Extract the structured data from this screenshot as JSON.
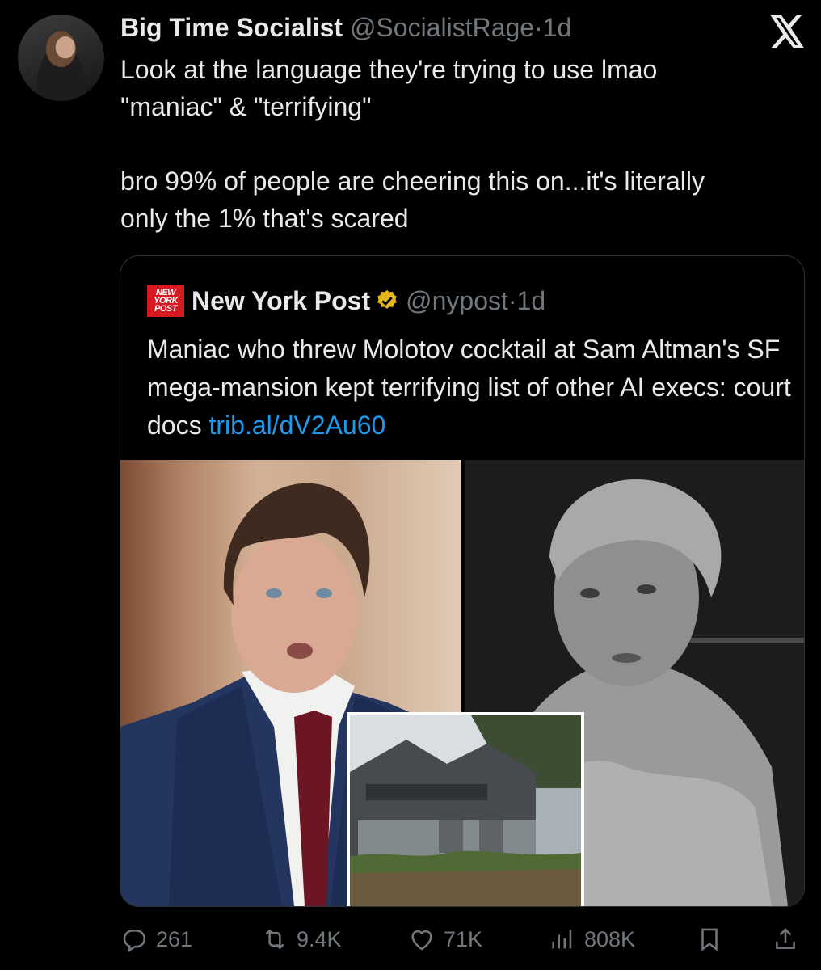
{
  "tweet": {
    "author_name": "Big Time Socialist",
    "handle": "@SocialistRage",
    "separator": "·",
    "time": "1d",
    "text_lines": [
      "Look at the language they're trying to use lmao",
      "\"maniac\" & \"terrifying\"",
      "",
      "bro 99% of people are cheering this on...it's literally",
      "only the 1% that's scared"
    ]
  },
  "quote": {
    "logo_lines": [
      "NEW",
      "YORK",
      "POST"
    ],
    "author_name": "New York Post",
    "handle": "@nypost",
    "separator": "·",
    "time": "1d",
    "text": "Maniac who threw Molotov cocktail at Sam Altman's SF mega-mansion kept terrifying list of other AI execs: court docs",
    "link": "trib.al/dV2Au60"
  },
  "actions": {
    "replies": "261",
    "reposts": "9.4K",
    "likes": "71K",
    "views": "808K"
  },
  "icons": {
    "brand": "x-logo-icon",
    "verified": "gold-verified-badge-icon",
    "reply": "reply-icon",
    "repost": "repost-icon",
    "like": "heart-icon",
    "views": "views-icon",
    "bookmark": "bookmark-icon",
    "share": "share-icon"
  },
  "colors": {
    "background": "#000000",
    "text": "#e7e9ea",
    "muted": "#71767b",
    "link": "#1d9bf0",
    "verified_gold": "#e2b719",
    "nypost_red": "#d71920"
  }
}
